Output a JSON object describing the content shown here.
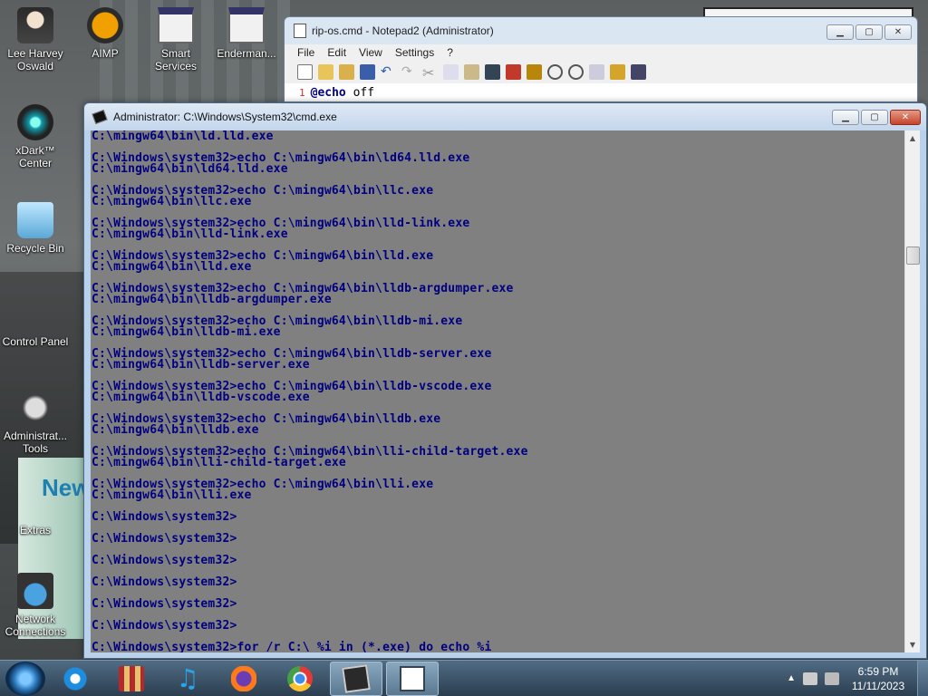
{
  "desktop": {
    "icons": [
      {
        "label": "Lee Harvey Oswald",
        "icon": "person-icon"
      },
      {
        "label": "AIMP",
        "icon": "aimp-icon"
      },
      {
        "label": "Smart Services",
        "icon": "app-icon"
      },
      {
        "label": "Enderman...",
        "icon": "app-icon"
      },
      {
        "label": "xDark™ Center",
        "icon": "xdark-icon"
      },
      {
        "label": "Recycle Bin",
        "icon": "recycle-bin-icon"
      },
      {
        "label": "Control Panel",
        "icon": "control-panel-icon"
      },
      {
        "label": "Administrat... Tools",
        "icon": "admin-tools-icon"
      },
      {
        "label": "Extras",
        "icon": "extras-icon"
      },
      {
        "label": "Network Connections",
        "icon": "network-icon"
      }
    ]
  },
  "notepad": {
    "title": "rip-os.cmd - Notepad2 (Administrator)",
    "menu": [
      "File",
      "Edit",
      "View",
      "Settings",
      "?"
    ],
    "line_number": "1",
    "code_keyword": "@echo",
    "code_rest": " off"
  },
  "cmd": {
    "title": "Administrator: C:\\Windows\\System32\\cmd.exe",
    "lines": [
      "C:\\mingw64\\bin\\ld.lld.exe",
      "",
      "C:\\Windows\\system32>echo C:\\mingw64\\bin\\ld64.lld.exe",
      "C:\\mingw64\\bin\\ld64.lld.exe",
      "",
      "C:\\Windows\\system32>echo C:\\mingw64\\bin\\llc.exe",
      "C:\\mingw64\\bin\\llc.exe",
      "",
      "C:\\Windows\\system32>echo C:\\mingw64\\bin\\lld-link.exe",
      "C:\\mingw64\\bin\\lld-link.exe",
      "",
      "C:\\Windows\\system32>echo C:\\mingw64\\bin\\lld.exe",
      "C:\\mingw64\\bin\\lld.exe",
      "",
      "C:\\Windows\\system32>echo C:\\mingw64\\bin\\lldb-argdumper.exe",
      "C:\\mingw64\\bin\\lldb-argdumper.exe",
      "",
      "C:\\Windows\\system32>echo C:\\mingw64\\bin\\lldb-mi.exe",
      "C:\\mingw64\\bin\\lldb-mi.exe",
      "",
      "C:\\Windows\\system32>echo C:\\mingw64\\bin\\lldb-server.exe",
      "C:\\mingw64\\bin\\lldb-server.exe",
      "",
      "C:\\Windows\\system32>echo C:\\mingw64\\bin\\lldb-vscode.exe",
      "C:\\mingw64\\bin\\lldb-vscode.exe",
      "",
      "C:\\Windows\\system32>echo C:\\mingw64\\bin\\lldb.exe",
      "C:\\mingw64\\bin\\lldb.exe",
      "",
      "C:\\Windows\\system32>echo C:\\mingw64\\bin\\lli-child-target.exe",
      "C:\\mingw64\\bin\\lli-child-target.exe",
      "",
      "C:\\Windows\\system32>echo C:\\mingw64\\bin\\lli.exe",
      "C:\\mingw64\\bin\\lli.exe",
      "",
      "C:\\Windows\\system32>",
      "",
      "C:\\Windows\\system32>",
      "",
      "C:\\Windows\\system32>",
      "",
      "C:\\Windows\\system32>",
      "",
      "C:\\Windows\\system32>",
      "",
      "C:\\Windows\\system32>",
      "",
      "C:\\Windows\\system32>for /r C:\\ %i in (*.exe) do echo %i"
    ]
  },
  "taskbar": {
    "items": [
      "start-button",
      "internet-explorer-icon",
      "archive-icon",
      "music-icon",
      "firefox-icon",
      "chrome-icon",
      "cmd-icon",
      "notepad2-icon"
    ],
    "time": "6:59 PM",
    "date": "11/11/2023"
  }
}
